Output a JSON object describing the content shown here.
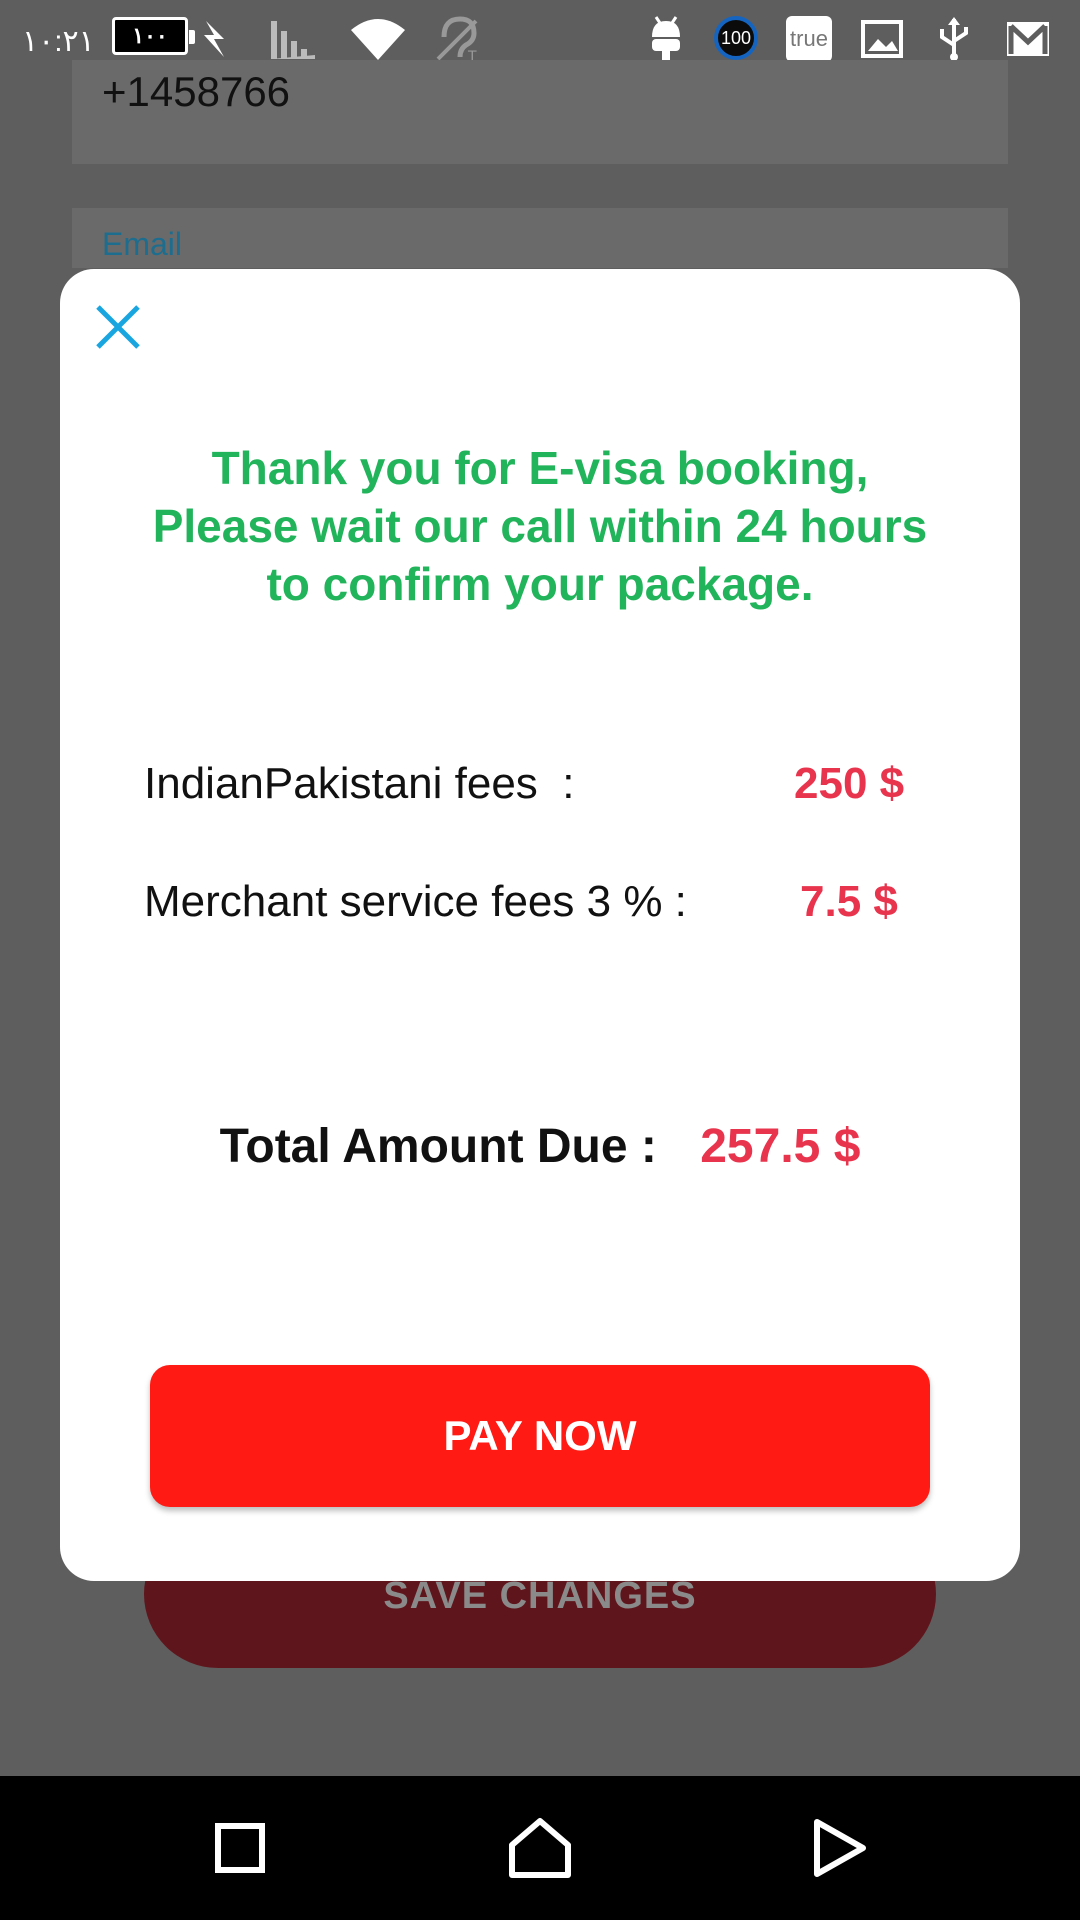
{
  "status_bar": {
    "time": "١٠:٢١",
    "battery_text": "١٠٠",
    "badge_100": "100",
    "badge_true": "true"
  },
  "background": {
    "phone_value": "+1458766",
    "email_label": "Email",
    "save_button_label": "SAVE CHANGES"
  },
  "modal": {
    "message_lines": [
      "Thank you for E-visa booking,",
      "Please wait our call within 24 hours",
      "to confirm your package."
    ],
    "fees": [
      {
        "label": "IndianPakistani fees  :",
        "value": "250 $"
      },
      {
        "label": "Merchant service fees 3 % :",
        "value": "7.5 $"
      }
    ],
    "total_label": "Total Amount Due :",
    "total_value": "257.5 $",
    "pay_button_label": "PAY NOW"
  },
  "colors": {
    "message": "#22b45b",
    "amount": "#e8344d",
    "pay_button": "#ff1a14",
    "close_icon": "#19a6e0"
  }
}
